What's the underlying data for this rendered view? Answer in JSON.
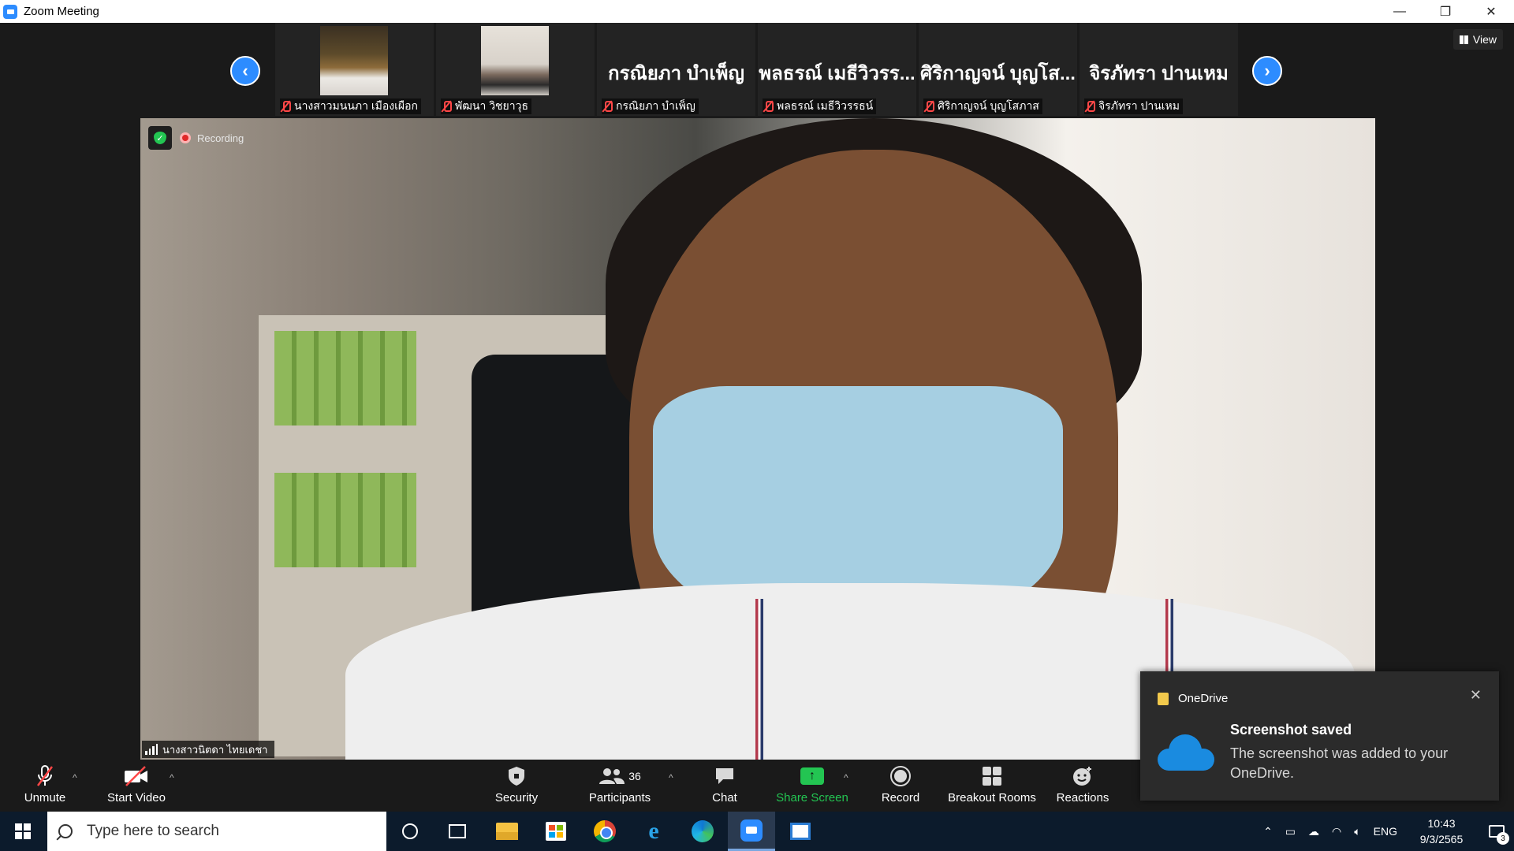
{
  "window": {
    "title": "Zoom Meeting",
    "minimize": "—",
    "restore": "❐",
    "close": "✕"
  },
  "gallery": {
    "prev_glyph": "‹",
    "next_glyph": "›",
    "view_label": "View",
    "tiles": [
      {
        "has_video": true,
        "big_name": "",
        "label": "นางสาวมนนภา เมืองเผือก",
        "muted": true
      },
      {
        "has_video": true,
        "big_name": "",
        "label": "พัฒนา วิชยาวุธ",
        "muted": true
      },
      {
        "has_video": false,
        "big_name": "กรณิยภา บำเพ็ญ",
        "label": "กรณิยภา บำเพ็ญ",
        "muted": true
      },
      {
        "has_video": false,
        "big_name": "พลธรณ์ เมธีวิวรร...",
        "label": "พลธรณ์ เมธีวิวรรธน์",
        "muted": true
      },
      {
        "has_video": false,
        "big_name": "ศิริกาญจน์ บุญโส...",
        "label": "ศิริกาญจน์ บุญโสภาส",
        "muted": true
      },
      {
        "has_video": false,
        "big_name": "จิรภัทรา ปานเหม",
        "label": "จิรภัทรา ปานเหม",
        "muted": true
      }
    ]
  },
  "main_video": {
    "recording_label": "Recording",
    "speaker_name": "นางสาวนิตดา ไทยเดชา"
  },
  "toolbar": {
    "unmute": "Unmute",
    "start_video": "Start Video",
    "security": "Security",
    "participants": "Participants",
    "participants_count": "36",
    "chat": "Chat",
    "share_screen": "Share Screen",
    "record": "Record",
    "breakout_rooms": "Breakout Rooms",
    "reactions": "Reactions",
    "caret": "^"
  },
  "toast": {
    "app_name": "OneDrive",
    "title": "Screenshot saved",
    "body": "The screenshot was added to your OneDrive.",
    "close_glyph": "✕"
  },
  "taskbar": {
    "search_placeholder": "Type here to search",
    "language": "ENG",
    "time": "10:43",
    "date": "9/3/2565",
    "notification_count": "3"
  },
  "colors": {
    "zoom_blue": "#2d8cff",
    "share_green": "#23c552",
    "muted_red": "#ff4747",
    "onedrive_blue": "#1a8be0"
  }
}
